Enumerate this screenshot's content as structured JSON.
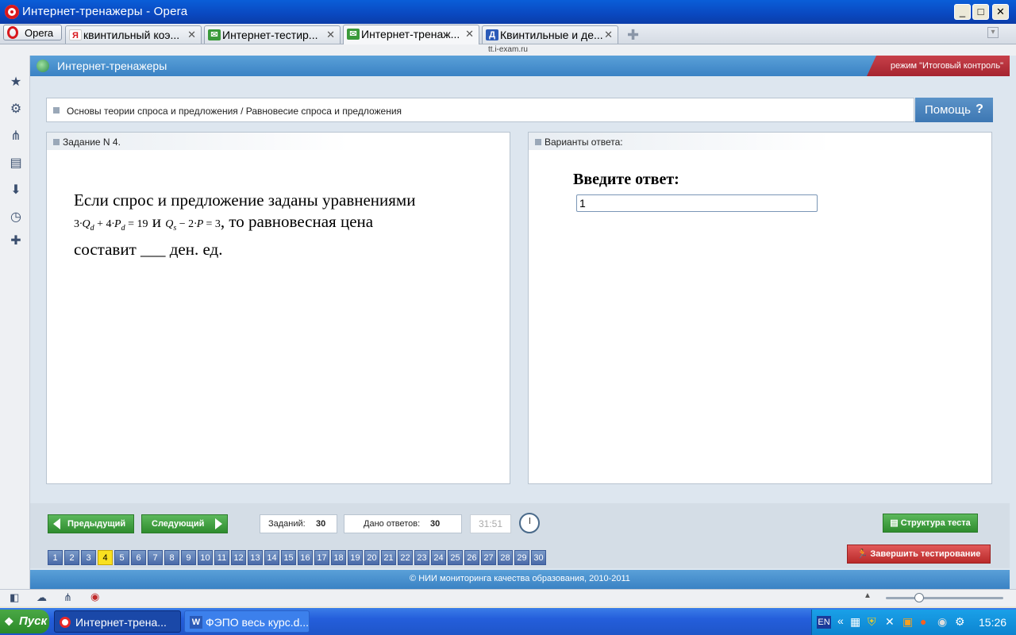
{
  "window": {
    "title": "Интернет-тренажеры - Opera"
  },
  "browser": {
    "menu_label": "Opera",
    "tabs": [
      {
        "label": "квинтильный коэ...",
        "favicon": "Я",
        "active": false
      },
      {
        "label": "Интернет-тестир...",
        "active": false
      },
      {
        "label": "Интернет-тренаж...",
        "active": true
      },
      {
        "label": "Квинтильные и де...",
        "favicon": "Д",
        "active": false
      }
    ],
    "address": "tt.i-exam.ru"
  },
  "header": {
    "title": "Интернет-тренажеры",
    "mode": "режим \"Итоговый контроль\""
  },
  "breadcrumb": "Основы теории спроса и предложения / Равновесие спроса и предложения",
  "help": {
    "label": "Помощь",
    "icon": "?"
  },
  "question": {
    "header": "Задание N 4.",
    "text_1": "Если спрос и предложение заданы уравнениями",
    "eq1_a": "3",
    "eq1_q": "Q",
    "eq1_sub": "d",
    "eq1_b": "+ 4",
    "eq1_p": "P",
    "eq1_psub": "d",
    "eq1_c": "= 19",
    "and": "и",
    "eq2_q": "Q",
    "eq2_sub": "s",
    "eq2_b": "− 2",
    "eq2_p": "P",
    "eq2_c": "= 3",
    "text_2": ", то равновесная цена",
    "text_3": "составит ___  ден. ед."
  },
  "answer": {
    "header": "Варианты ответа:",
    "label": "Введите ответ:",
    "value": "1"
  },
  "nav": {
    "prev": "Предыдущий",
    "next": "Следующий",
    "tasks_label": "Заданий:",
    "tasks_count": "30",
    "answered_label": "Дано ответов:",
    "answered_count": "30",
    "timer": "31:51",
    "structure": "Структура теста",
    "finish": "Завершить тестирование",
    "current": 4,
    "numbers": [
      "1",
      "2",
      "3",
      "4",
      "5",
      "6",
      "7",
      "8",
      "9",
      "10",
      "11",
      "12",
      "13",
      "14",
      "15",
      "16",
      "17",
      "18",
      "19",
      "20",
      "21",
      "22",
      "23",
      "24",
      "25",
      "26",
      "27",
      "28",
      "29",
      "30"
    ]
  },
  "footer": "© НИИ мониторинга качества образования, 2010-2011",
  "taskbar": {
    "start": "Пуск",
    "tasks": [
      "Интернет-трена...",
      "ФЭПО весь курс.d..."
    ],
    "lang": "EN",
    "time": "15:26"
  }
}
